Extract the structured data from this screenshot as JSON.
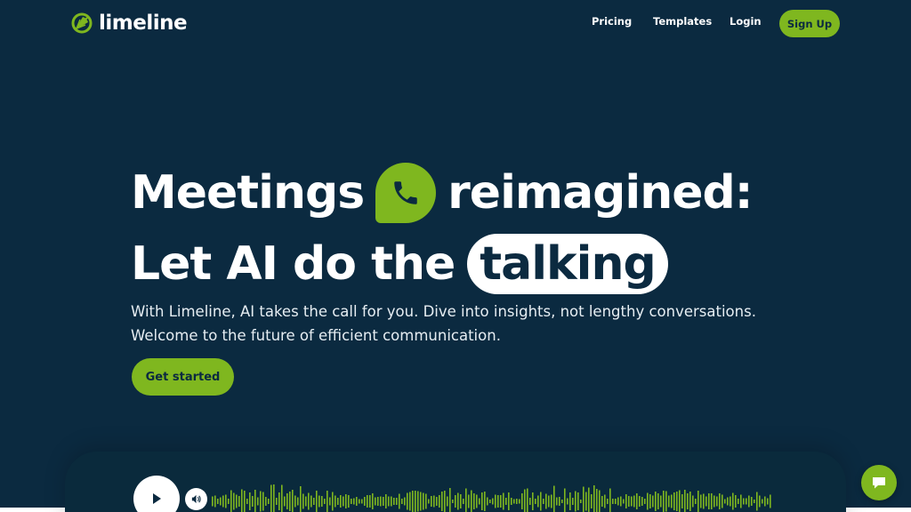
{
  "brand": {
    "name": "limeline",
    "accent": "#7fb71f",
    "background": "#0b2a40"
  },
  "nav": {
    "pricing": "Pricing",
    "templates": "Templates",
    "login": "Login",
    "signup": "Sign Up"
  },
  "hero": {
    "line1_before": "Meetings",
    "line1_icon": "phone-icon",
    "line1_after": "reimagined:",
    "line2_before": "Let AI do the",
    "line2_highlight": "talking",
    "subtitle": "With Limeline, AI takes the call for you. Dive into insights, not lengthy conversations. Welcome to the future of efficient communication.",
    "cta": "Get started"
  },
  "audio_player": {
    "play_icon": "play-icon",
    "volume_icon": "volume-icon",
    "waveform_color": "#7fb71f"
  },
  "chat_widget": {
    "icon": "chat-bubble-icon"
  }
}
